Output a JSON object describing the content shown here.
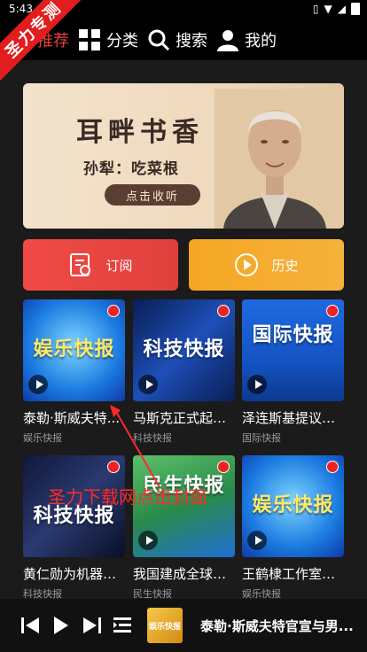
{
  "status": {
    "time": "5:43"
  },
  "nav": {
    "items": [
      {
        "label": "推荐",
        "icon": "recommend"
      },
      {
        "label": "分类",
        "icon": "grid-icon"
      },
      {
        "label": "搜索",
        "icon": "search-icon"
      },
      {
        "label": "我的",
        "icon": "user-icon"
      }
    ]
  },
  "watermark": {
    "ribbon": "圣力专测",
    "overlay": "圣力下载网点击封面"
  },
  "banner": {
    "title": "耳畔书香",
    "subtitle": "孙犁：吃菜根",
    "button": "点击收听"
  },
  "actions": {
    "subscribe": "订阅",
    "history": "历史"
  },
  "cards": [
    {
      "title": "泰勒·斯威夫特...",
      "category": "娱乐快报",
      "cover_text": "娱乐快报"
    },
    {
      "title": "马斯克正式起诉...",
      "category": "科技快报",
      "cover_text": "科技快报"
    },
    {
      "title": "泽连斯基提议由...",
      "category": "国际快报",
      "cover_text": "国际快报"
    },
    {
      "title": "黄仁勋为机器人...",
      "category": "科技快报",
      "cover_text": "科技快报"
    },
    {
      "title": "我国建成全球最...",
      "category": "民生快报",
      "cover_text": "民生快报"
    },
    {
      "title": "王鹤棣工作室发...",
      "category": "娱乐快报",
      "cover_text": "娱乐快报"
    }
  ],
  "player": {
    "now_playing": "泰勒·斯威夫特官宣与男...",
    "cover_text": "娱乐快报"
  },
  "colors": {
    "accent": "#e8413b",
    "subscribe": "#f04a46",
    "history": "#f5a623"
  }
}
